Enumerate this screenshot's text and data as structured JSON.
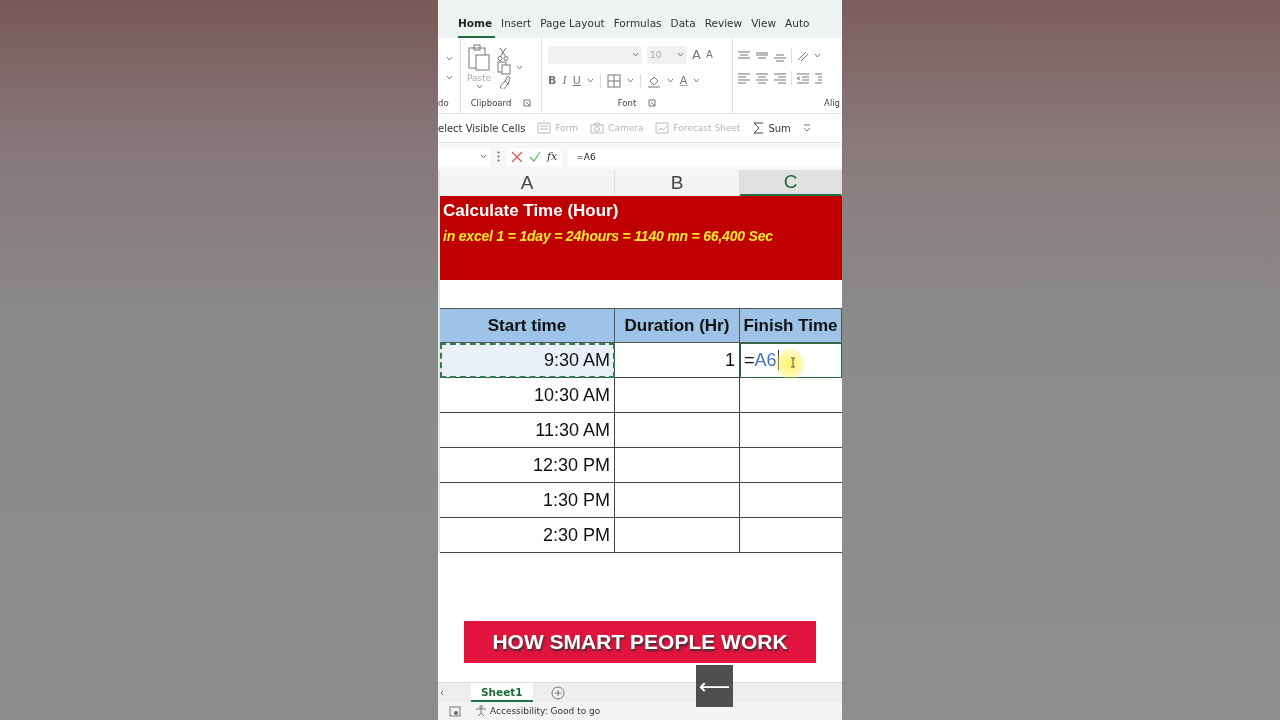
{
  "ribbon": {
    "tabs": [
      {
        "label": "Home",
        "selected": true
      },
      {
        "label": "Insert",
        "selected": false
      },
      {
        "label": "Page Layout",
        "selected": false
      },
      {
        "label": "Formulas",
        "selected": false
      },
      {
        "label": "Data",
        "selected": false
      },
      {
        "label": "Review",
        "selected": false
      },
      {
        "label": "View",
        "selected": false
      },
      {
        "label": "Auto",
        "selected": false
      }
    ],
    "undo_group": {
      "label": "do"
    },
    "clipboard": {
      "label": "Clipboard",
      "paste_label": "Paste"
    },
    "font": {
      "label": "Font",
      "size": "10",
      "grow": "A",
      "shrink": "A",
      "bold": "B",
      "italic": "I",
      "underline": "U",
      "font_color": "A"
    },
    "alignment": {
      "label": "Alig"
    }
  },
  "quick_toolbar": [
    {
      "kind": "text",
      "label": "elect Visible Cells",
      "disabled": false
    },
    {
      "kind": "form",
      "label": "Form",
      "disabled": true
    },
    {
      "kind": "camera",
      "label": "Camera",
      "disabled": true
    },
    {
      "kind": "forecast",
      "label": "Forecast Sheet",
      "disabled": true
    },
    {
      "kind": "sum",
      "label": "Sum",
      "disabled": false
    }
  ],
  "formula_bar": {
    "fx": "fx",
    "value": "=A6"
  },
  "columns": [
    {
      "label": "A",
      "selected": false
    },
    {
      "label": "B",
      "selected": false
    },
    {
      "label": "C",
      "selected": true
    }
  ],
  "banner": {
    "title": "Calculate Time (Hour)",
    "subtitle": "in excel 1 = 1day = 24hours = 1140 mn = 66,400 Sec"
  },
  "table": {
    "headers": [
      "Start time",
      "Duration (Hr)",
      "Finish Time"
    ],
    "rows": [
      {
        "start": "9:30 AM",
        "duration": "1",
        "finish": "=A6",
        "copy_marquee": true,
        "editing": true
      },
      {
        "start": "10:30 AM",
        "copy_marquee": false,
        "editing": false
      },
      {
        "start": "11:30 AM",
        "copy_marquee": false,
        "editing": false
      },
      {
        "start": "12:30 PM",
        "copy_marquee": false,
        "editing": false
      },
      {
        "start": "1:30 PM",
        "copy_marquee": false,
        "editing": false
      },
      {
        "start": "2:30 PM",
        "copy_marquee": false,
        "editing": false
      }
    ]
  },
  "caption": "HOW SMART PEOPLE WORK",
  "back_button": "⟵",
  "sheet_tabs": [
    {
      "label": "Sheet1",
      "selected": true
    }
  ],
  "status_bar": {
    "accessibility": "Accessibility: Good to go"
  }
}
